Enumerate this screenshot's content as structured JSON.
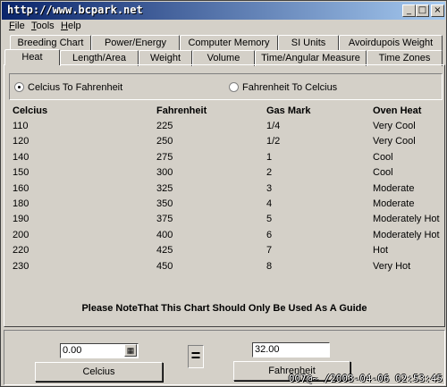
{
  "window": {
    "title": "http://www.bcpark.net",
    "controls": {
      "minimize": "_",
      "maximize": "□",
      "close": "×"
    }
  },
  "menu": {
    "items": [
      {
        "first": "F",
        "rest": "ile"
      },
      {
        "first": "T",
        "rest": "ools"
      },
      {
        "first": "H",
        "rest": "elp"
      }
    ]
  },
  "tabs": {
    "row1": [
      "Breeding Chart",
      "Power/Energy",
      "Computer Memory",
      "SI Units",
      "Avoirdupois Weight"
    ],
    "row2": [
      "Heat",
      "Length/Area",
      "Weight",
      "Volume",
      "Time/Angular Measure",
      "Time Zones"
    ],
    "active": "Heat"
  },
  "direction": {
    "option1": "Celcius To Fahrenheit",
    "option2": "Fahrenheit To Celcius",
    "selected": "option1"
  },
  "table": {
    "headers": [
      "Celcius",
      "Fahrenheit",
      "Gas Mark",
      "Oven Heat"
    ],
    "rows": [
      [
        "110",
        "225",
        "1/4",
        "Very Cool"
      ],
      [
        "120",
        "250",
        "1/2",
        "Very Cool"
      ],
      [
        "140",
        "275",
        "1",
        "Cool"
      ],
      [
        "150",
        "300",
        "2",
        "Cool"
      ],
      [
        "160",
        "325",
        "3",
        "Moderate"
      ],
      [
        "180",
        "350",
        "4",
        "Moderate"
      ],
      [
        "190",
        "375",
        "5",
        "Moderately Hot"
      ],
      [
        "200",
        "400",
        "6",
        "Moderately Hot"
      ],
      [
        "220",
        "425",
        "7",
        "Hot"
      ],
      [
        "230",
        "450",
        "8",
        "Very Hot"
      ]
    ]
  },
  "note": "Please NoteThat This Chart Should Only Be Used As A Guide",
  "converter": {
    "input_value": "0.00",
    "output_value": "32.00",
    "equals": "=",
    "input_button": "Celcius",
    "output_button": "Fahrenheit"
  },
  "watermark": "007@~ /2003-04-06 02:53:45"
}
